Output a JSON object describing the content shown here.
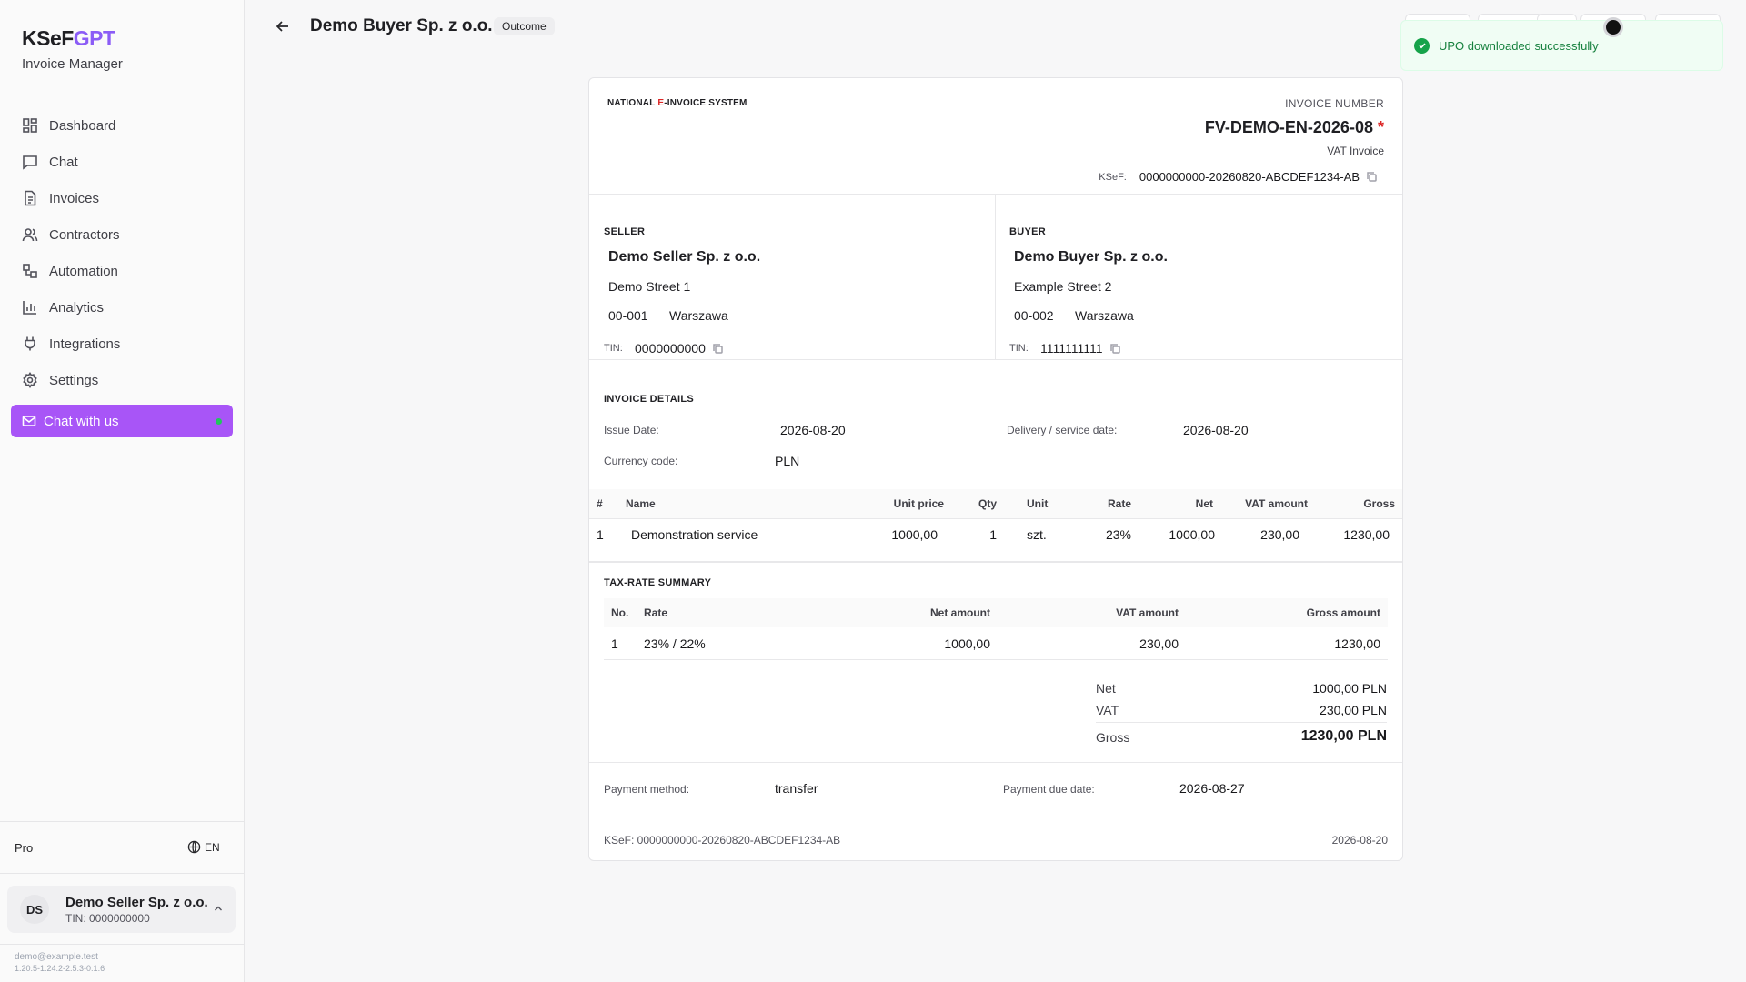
{
  "app": {
    "logo_main": "KSeF",
    "logo_accent": "GPT",
    "subtitle": "Invoice Manager"
  },
  "sidebar": {
    "items": [
      {
        "label": "Dashboard",
        "icon": "dashboard-icon"
      },
      {
        "label": "Chat",
        "icon": "chat-icon"
      },
      {
        "label": "Invoices",
        "icon": "invoice-icon"
      },
      {
        "label": "Contractors",
        "icon": "users-icon"
      },
      {
        "label": "Automation",
        "icon": "automation-icon"
      },
      {
        "label": "Analytics",
        "icon": "analytics-icon"
      },
      {
        "label": "Integrations",
        "icon": "plug-icon"
      },
      {
        "label": "Settings",
        "icon": "gear-icon"
      }
    ],
    "chat_button": "Chat with us",
    "plan": "Pro",
    "language": "EN",
    "user": {
      "initials": "DS",
      "name": "Demo Seller Sp. z o.o.",
      "tin": "TIN: 0000000000"
    },
    "email": "demo@example.test",
    "version": "1.20.5-1.24.2-2.5.3-0.1.6"
  },
  "header": {
    "title": "Demo Buyer Sp. z o.o.",
    "badge": "Outcome"
  },
  "toast": {
    "message": "UPO downloaded successfully",
    "color": "#16a34a"
  },
  "invoice": {
    "system_pre": "NATIONAL ",
    "system_e": "E",
    "system_post": "-INVOICE SYSTEM",
    "number_label": "INVOICE NUMBER",
    "number": "FV-DEMO-EN-2026-08",
    "type": "VAT Invoice",
    "ksef_label": "KSeF:",
    "ksef_number": "0000000000-20260820-ABCDEF1234-AB",
    "seller": {
      "label": "SELLER",
      "name": "Demo Seller Sp. z o.o.",
      "street": "Demo Street 1",
      "zip": "00-001",
      "city": "Warszawa",
      "tin_label": "TIN:",
      "tin": "0000000000"
    },
    "buyer": {
      "label": "BUYER",
      "name": "Demo Buyer Sp. z o.o.",
      "street": "Example Street 2",
      "zip": "00-002",
      "city": "Warszawa",
      "tin_label": "TIN:",
      "tin": "1111111111"
    },
    "details": {
      "title": "INVOICE DETAILS",
      "issue_date_label": "Issue Date:",
      "issue_date": "2026-08-20",
      "delivery_label": "Delivery / service date:",
      "delivery_date": "2026-08-20",
      "currency_label": "Currency code:",
      "currency": "PLN"
    },
    "items_table": {
      "headers": [
        "#",
        "Name",
        "Unit price",
        "Qty",
        "Unit",
        "Rate",
        "Net",
        "VAT amount",
        "Gross"
      ],
      "rows": [
        [
          "1",
          "Demonstration service",
          "1000,00",
          "1",
          "szt.",
          "23%",
          "1000,00",
          "230,00",
          "1230,00"
        ]
      ]
    },
    "summary": {
      "title": "TAX-RATE SUMMARY",
      "headers": [
        "No.",
        "Rate",
        "Net amount",
        "VAT amount",
        "Gross amount"
      ],
      "rows": [
        [
          "1",
          "23% / 22%",
          "1000,00",
          "230,00",
          "1230,00"
        ]
      ]
    },
    "totals": {
      "net_label": "Net",
      "net": "1000,00 PLN",
      "vat_label": "VAT",
      "vat": "230,00 PLN",
      "gross_label": "Gross",
      "gross": "1230,00 PLN"
    },
    "payment": {
      "method_label": "Payment method:",
      "method": "transfer",
      "due_label": "Payment due date:",
      "due": "2026-08-27"
    },
    "footer": {
      "ksef": "KSeF: 0000000000-20260820-ABCDEF1234-AB",
      "date": "2026-08-20"
    }
  }
}
